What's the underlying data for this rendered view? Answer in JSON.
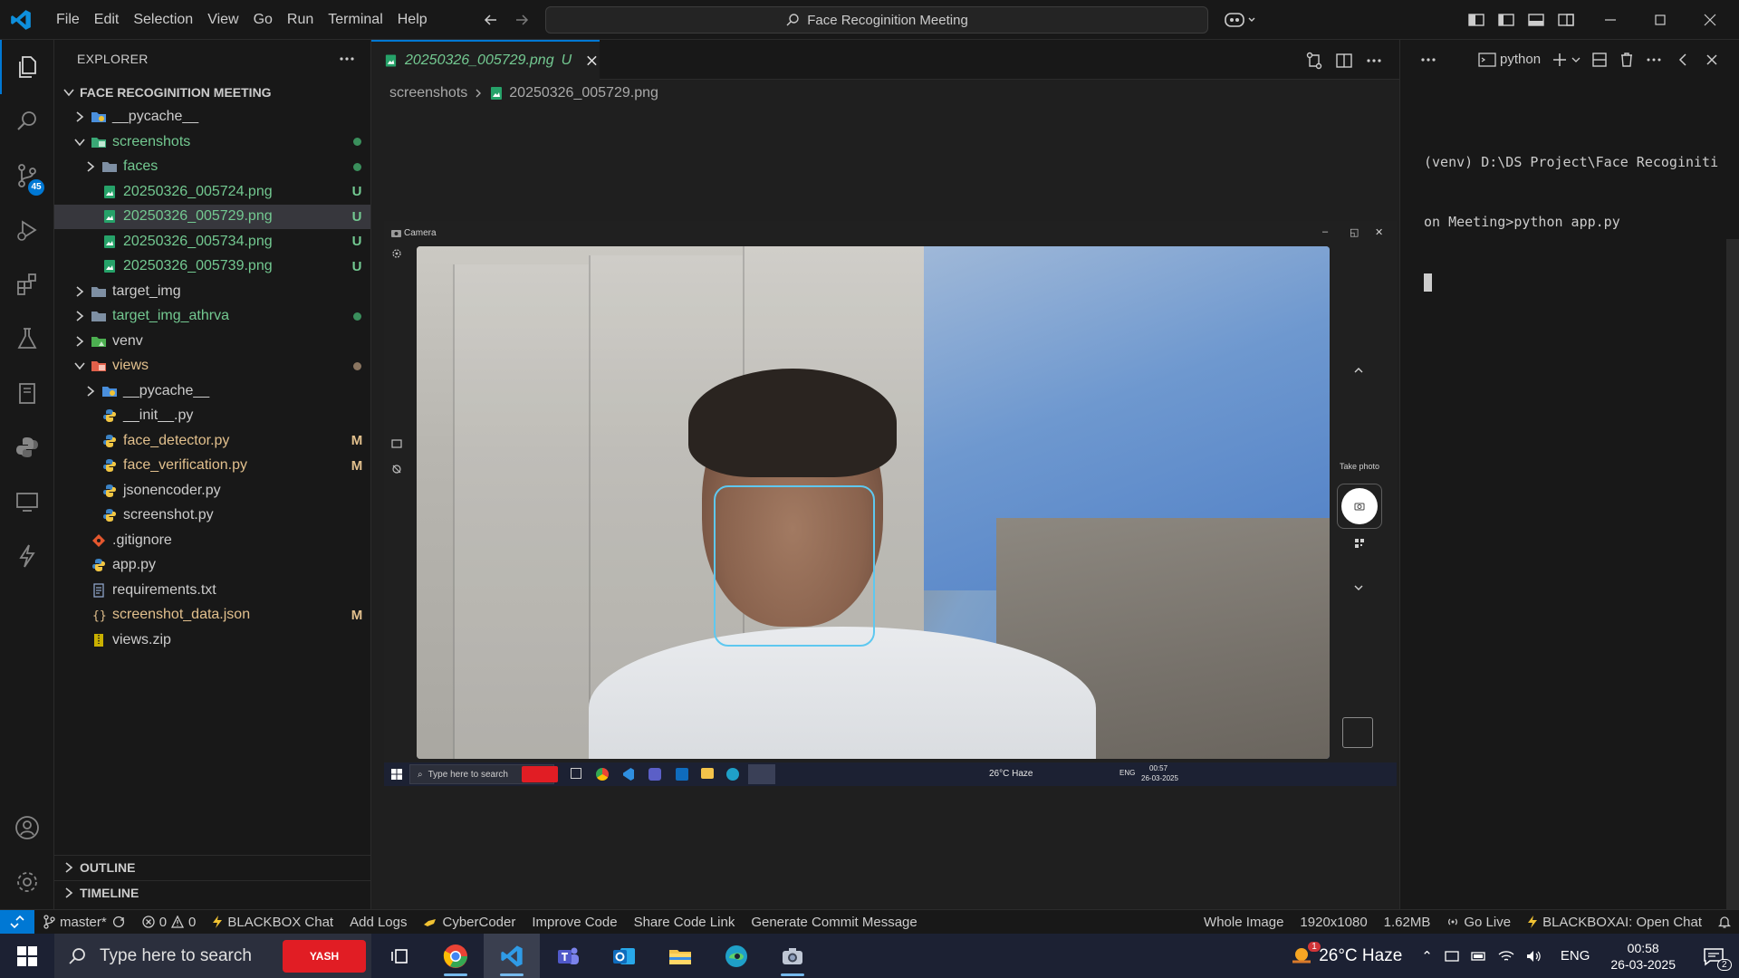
{
  "titlebar": {
    "menu": [
      "File",
      "Edit",
      "Selection",
      "View",
      "Go",
      "Run",
      "Terminal",
      "Help"
    ],
    "command_center": "Face Recoginition Meeting"
  },
  "activity": {
    "source_control_badge": "45"
  },
  "explorer": {
    "title": "EXPLORER",
    "project": "FACE RECOGINITION MEETING",
    "items": [
      {
        "label": "__pycache__",
        "depth": 1,
        "chevron": "right",
        "icon": "folder-blue",
        "status": "",
        "color": "def"
      },
      {
        "label": "screenshots",
        "depth": 1,
        "chevron": "down",
        "icon": "folder-image",
        "status": "dot",
        "color": "new"
      },
      {
        "label": "faces",
        "depth": 2,
        "chevron": "right",
        "icon": "folder",
        "status": "dot",
        "color": "new"
      },
      {
        "label": "20250326_005724.png",
        "depth": 2,
        "chevron": "",
        "icon": "image",
        "status": "U",
        "color": "new"
      },
      {
        "label": "20250326_005729.png",
        "depth": 2,
        "chevron": "",
        "icon": "image",
        "status": "U",
        "color": "new",
        "selected": true
      },
      {
        "label": "20250326_005734.png",
        "depth": 2,
        "chevron": "",
        "icon": "image",
        "status": "U",
        "color": "new"
      },
      {
        "label": "20250326_005739.png",
        "depth": 2,
        "chevron": "",
        "icon": "image",
        "status": "U",
        "color": "new"
      },
      {
        "label": "target_img",
        "depth": 1,
        "chevron": "right",
        "icon": "folder",
        "status": "",
        "color": "def"
      },
      {
        "label": "target_img_athrva",
        "depth": 1,
        "chevron": "right",
        "icon": "folder",
        "status": "dot",
        "color": "new"
      },
      {
        "label": "venv",
        "depth": 1,
        "chevron": "right",
        "icon": "folder-green",
        "status": "",
        "color": "def"
      },
      {
        "label": "views",
        "depth": 1,
        "chevron": "down",
        "icon": "folder-red",
        "status": "dotmod",
        "color": "mod"
      },
      {
        "label": "__pycache__",
        "depth": 2,
        "chevron": "right",
        "icon": "folder-blue",
        "status": "",
        "color": "def"
      },
      {
        "label": "__init__.py",
        "depth": 2,
        "chevron": "",
        "icon": "python",
        "status": "",
        "color": "def"
      },
      {
        "label": "face_detector.py",
        "depth": 2,
        "chevron": "",
        "icon": "python",
        "status": "M",
        "color": "mod"
      },
      {
        "label": "face_verification.py",
        "depth": 2,
        "chevron": "",
        "icon": "python",
        "status": "M",
        "color": "mod"
      },
      {
        "label": "jsonencoder.py",
        "depth": 2,
        "chevron": "",
        "icon": "python",
        "status": "",
        "color": "def"
      },
      {
        "label": "screenshot.py",
        "depth": 2,
        "chevron": "",
        "icon": "python",
        "status": "",
        "color": "def"
      },
      {
        "label": ".gitignore",
        "depth": 1,
        "chevron": "",
        "icon": "git",
        "status": "",
        "color": "def"
      },
      {
        "label": "app.py",
        "depth": 1,
        "chevron": "",
        "icon": "python",
        "status": "",
        "color": "def"
      },
      {
        "label": "requirements.txt",
        "depth": 1,
        "chevron": "",
        "icon": "text",
        "status": "",
        "color": "def"
      },
      {
        "label": "screenshot_data.json",
        "depth": 1,
        "chevron": "",
        "icon": "json",
        "status": "M",
        "color": "mod"
      },
      {
        "label": "views.zip",
        "depth": 1,
        "chevron": "",
        "icon": "zip",
        "status": "",
        "color": "def"
      }
    ],
    "outline": "OUTLINE",
    "timeline": "TIMELINE"
  },
  "editor": {
    "tab_name": "20250326_005729.png",
    "tab_status": "U",
    "breadcrumb_folder": "screenshots",
    "breadcrumb_file": "20250326_005729.png",
    "screenshot": {
      "camera_title": "Camera",
      "take_photo": "Take photo",
      "search": "Type here to search",
      "weather": "26°C Haze",
      "lang": "ENG",
      "time": "00:57",
      "date": "26-03-2025"
    }
  },
  "panel": {
    "terminal_name": "python",
    "lines": [
      "(venv) D:\\DS Project\\Face Recoginiti",
      "on Meeting>python app.py"
    ]
  },
  "statusbar": {
    "branch": "master*",
    "errors": "0",
    "warnings": "0",
    "left_items": [
      "BLACKBOX Chat",
      "Add Logs",
      "CyberCoder",
      "Improve Code",
      "Share Code Link",
      "Generate Commit Message"
    ],
    "right_items": [
      "Whole Image",
      "1920x1080",
      "1.62MB",
      "Go Live",
      "BLACKBOXAI: Open Chat"
    ]
  },
  "taskbar": {
    "search": "Type here to search",
    "yash_label": "YASH",
    "weather": "26°C  Haze",
    "lang": "ENG",
    "time": "00:58",
    "date": "26-03-2025",
    "notif_count": "2",
    "weather_badge": "1"
  },
  "colors": {
    "accent": "#0078d4",
    "untracked": "#73c991",
    "modified": "#e2c08d",
    "face_box": "#5ec8f0"
  }
}
